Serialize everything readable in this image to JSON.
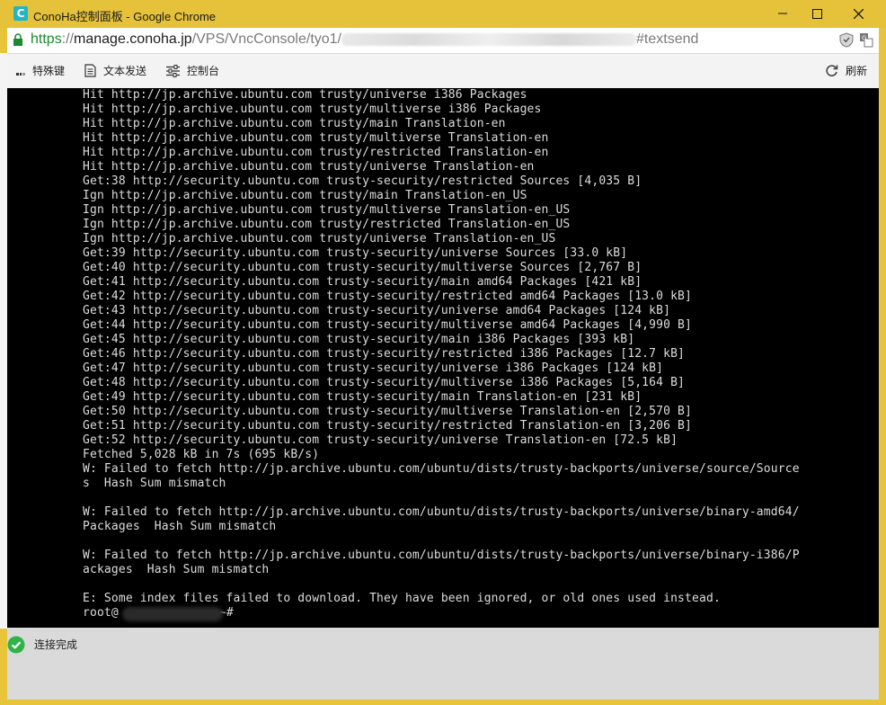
{
  "window": {
    "title": "ConoHa控制面板 - Google Chrome",
    "app_icon_letter": "C"
  },
  "address_bar": {
    "scheme": "https",
    "separator": "://",
    "host": "manage.conoha.jp",
    "path": "/VPS/VncConsole/tyo1/",
    "fragment": "#textsend"
  },
  "toolbar": {
    "special_keys_label": "特殊键",
    "send_text_label": "文本发送",
    "console_label": "控制台",
    "refresh_label": "刷新"
  },
  "console": {
    "lines": [
      "Hit http://jp.archive.ubuntu.com trusty/universe i386 Packages",
      "Hit http://jp.archive.ubuntu.com trusty/multiverse i386 Packages",
      "Hit http://jp.archive.ubuntu.com trusty/main Translation-en",
      "Hit http://jp.archive.ubuntu.com trusty/multiverse Translation-en",
      "Hit http://jp.archive.ubuntu.com trusty/restricted Translation-en",
      "Hit http://jp.archive.ubuntu.com trusty/universe Translation-en",
      "Get:38 http://security.ubuntu.com trusty-security/restricted Sources [4,035 B]",
      "Ign http://jp.archive.ubuntu.com trusty/main Translation-en_US",
      "Ign http://jp.archive.ubuntu.com trusty/multiverse Translation-en_US",
      "Ign http://jp.archive.ubuntu.com trusty/restricted Translation-en_US",
      "Ign http://jp.archive.ubuntu.com trusty/universe Translation-en_US",
      "Get:39 http://security.ubuntu.com trusty-security/universe Sources [33.0 kB]",
      "Get:40 http://security.ubuntu.com trusty-security/multiverse Sources [2,767 B]",
      "Get:41 http://security.ubuntu.com trusty-security/main amd64 Packages [421 kB]",
      "Get:42 http://security.ubuntu.com trusty-security/restricted amd64 Packages [13.0 kB]",
      "Get:43 http://security.ubuntu.com trusty-security/universe amd64 Packages [124 kB]",
      "Get:44 http://security.ubuntu.com trusty-security/multiverse amd64 Packages [4,990 B]",
      "Get:45 http://security.ubuntu.com trusty-security/main i386 Packages [393 kB]",
      "Get:46 http://security.ubuntu.com trusty-security/restricted i386 Packages [12.7 kB]",
      "Get:47 http://security.ubuntu.com trusty-security/universe i386 Packages [124 kB]",
      "Get:48 http://security.ubuntu.com trusty-security/multiverse i386 Packages [5,164 B]",
      "Get:49 http://security.ubuntu.com trusty-security/main Translation-en [231 kB]",
      "Get:50 http://security.ubuntu.com trusty-security/multiverse Translation-en [2,570 B]",
      "Get:51 http://security.ubuntu.com trusty-security/restricted Translation-en [3,206 B]",
      "Get:52 http://security.ubuntu.com trusty-security/universe Translation-en [72.5 kB]",
      "Fetched 5,028 kB in 7s (695 kB/s)",
      "W: Failed to fetch http://jp.archive.ubuntu.com/ubuntu/dists/trusty-backports/universe/source/Source",
      "s  Hash Sum mismatch",
      "",
      "W: Failed to fetch http://jp.archive.ubuntu.com/ubuntu/dists/trusty-backports/universe/binary-amd64/",
      "Packages  Hash Sum mismatch",
      "",
      "W: Failed to fetch http://jp.archive.ubuntu.com/ubuntu/dists/trusty-backports/universe/binary-i386/P",
      "ackages  Hash Sum mismatch",
      "",
      "E: Some index files failed to download. They have been ignored, or old ones used instead."
    ],
    "prompt_prefix": "root@",
    "prompt_suffix": "~#"
  },
  "status": {
    "text": "连接完成",
    "color": "#2fb34a"
  },
  "colors": {
    "frame": "#e6c13a",
    "https": "#1b8a2f",
    "terminal_bg": "#000000",
    "terminal_fg": "#dcdcdc"
  }
}
